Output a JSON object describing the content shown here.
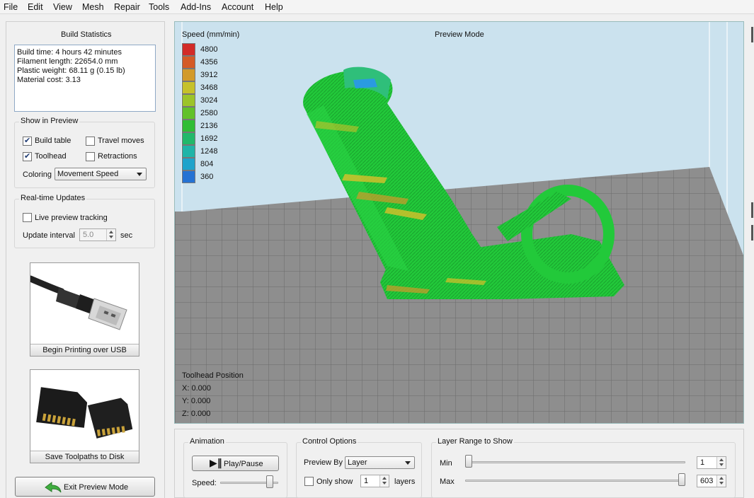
{
  "menu": [
    "File",
    "Edit",
    "View",
    "Mesh",
    "Repair",
    "Tools",
    "Add-Ins",
    "Account",
    "Help"
  ],
  "build_stats": {
    "title": "Build Statistics",
    "lines": [
      "Build time: 4 hours 42 minutes",
      "Filament length: 22654.0 mm",
      "Plastic weight: 68.11 g (0.15 lb)",
      "Material cost: 3.13"
    ]
  },
  "show_in_preview": {
    "title": "Show in Preview",
    "build_table": {
      "label": "Build table",
      "checked": true
    },
    "travel_moves": {
      "label": "Travel moves",
      "checked": false
    },
    "toolhead": {
      "label": "Toolhead",
      "checked": true
    },
    "retractions": {
      "label": "Retractions",
      "checked": false
    },
    "coloring_label": "Coloring",
    "coloring_value": "Movement Speed"
  },
  "realtime": {
    "title": "Real-time Updates",
    "live_tracking": {
      "label": "Live preview tracking",
      "checked": false
    },
    "interval_label": "Update interval",
    "interval_value": "5.0",
    "interval_unit": "sec"
  },
  "usb_button": {
    "label": "Begin Printing over USB",
    "icon": "usb-cable-icon"
  },
  "sd_button": {
    "label": "Save Toolpaths to Disk",
    "icon": "sd-card-icon"
  },
  "exit_button": {
    "label": "Exit Preview Mode",
    "icon": "back-arrow-icon"
  },
  "viewport": {
    "mode_label": "Preview Mode",
    "legend_title": "Speed (mm/min)",
    "legend": [
      {
        "value": "4800",
        "color": "#d22b28"
      },
      {
        "value": "4356",
        "color": "#d45a26"
      },
      {
        "value": "3912",
        "color": "#d29a2a"
      },
      {
        "value": "3468",
        "color": "#c6c12a"
      },
      {
        "value": "3024",
        "color": "#9cc42a"
      },
      {
        "value": "2580",
        "color": "#62c12a"
      },
      {
        "value": "2136",
        "color": "#2fbd35"
      },
      {
        "value": "1692",
        "color": "#21b86a"
      },
      {
        "value": "1248",
        "color": "#1fb4a8"
      },
      {
        "value": "804",
        "color": "#1ea3cb"
      },
      {
        "value": "360",
        "color": "#2572d3"
      }
    ],
    "toolhead_title": "Toolhead Position",
    "toolhead_x": "X: 0.000",
    "toolhead_y": "Y: 0.000",
    "toolhead_z": "Z: 0.000"
  },
  "animation": {
    "title": "Animation",
    "play_label": "Play/Pause",
    "speed_label": "Speed:",
    "speed_fraction": 0.9
  },
  "control_options": {
    "title": "Control Options",
    "preview_by_label": "Preview By",
    "preview_by_value": "Layer",
    "only_show": {
      "label": "Only show",
      "checked": false
    },
    "only_show_value": "1",
    "layers_label": "layers"
  },
  "layer_range": {
    "title": "Layer Range to Show",
    "min_label": "Min",
    "min_value": "1",
    "max_label": "Max",
    "max_value": "603",
    "min_fraction": 0.0,
    "max_fraction": 1.0
  },
  "colors": {
    "print_green": "#22c93a",
    "bed": "#8e8e8e",
    "sky": "#cbe2ee"
  }
}
